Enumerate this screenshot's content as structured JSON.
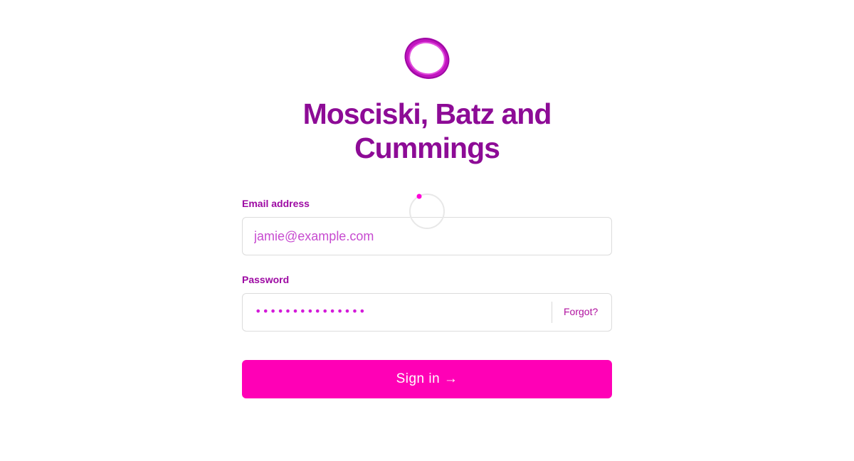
{
  "brand": {
    "logo_icon": "ring-logo-icon",
    "name": "Mosciski, Batz and Cummings",
    "color": "#8d0b96",
    "accent": "#ff00b6"
  },
  "form": {
    "email_label": "Email address",
    "email_placeholder": "jamie@example.com",
    "email_value": "",
    "password_label": "Password",
    "password_value": "•••••••••••••••",
    "forgot_label": "Forgot?",
    "submit_label": "Sign in →"
  },
  "loading": {
    "icon": "loading-spinner-icon"
  }
}
